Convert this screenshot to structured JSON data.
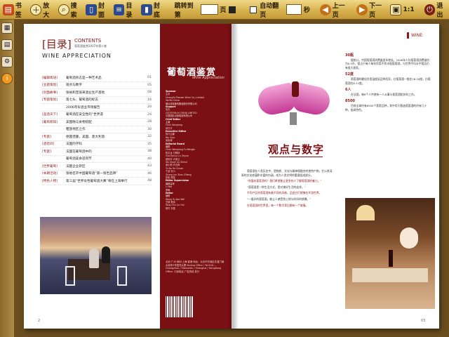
{
  "toolbar": {
    "bookmark": "书签",
    "zoom": "放大",
    "search": "搜索",
    "cover": "封面",
    "toc": "目录",
    "backcover": "封底",
    "jump_prefix": "跳转到第",
    "jump_suffix": "页",
    "autoflip": "自动翻页",
    "seconds": "秒",
    "prev": "上一页",
    "next": "下一页",
    "ratio": "1:1",
    "exit": "退出"
  },
  "contents": {
    "title": "[目录]",
    "en": "CONTENTS",
    "tiny": "葡萄酒鉴赏2007年第二卷",
    "wine_app": "WINE  APPRECIATION",
    "rows": [
      {
        "sec": "[编辑寄语]",
        "title": "葡萄酒杂志是一种艺术品",
        "pg": "01"
      },
      {
        "sec": "[主题策划]",
        "title": "观点与数字",
        "pg": "05"
      },
      {
        "sec": "[封面故事]",
        "title": "张裕和宝丽来酒业生产基地",
        "pg": "08"
      },
      {
        "sec": "[专题策划]",
        "title": "第七头、葡萄酒的标志",
        "pg": "16"
      },
      {
        "sec": "",
        "title": "2006年份酒业市场报告",
        "pg": "20"
      },
      {
        "sec": "[品酒天下]",
        "title": "葡萄酒在安全性的“世界遗",
        "pg": "24"
      },
      {
        "sec": "[葡萄新知]",
        "title": "美国晚与食物搭配",
        "pg": "28"
      },
      {
        "sec": "",
        "title": "粗放地区之作",
        "pg": "30"
      },
      {
        "sec": "[专题]",
        "title": "德国佳酿，美国、意大利酒",
        "pg": "32"
      },
      {
        "sec": "[酒窖间]",
        "title": "法国的学科",
        "pg": "35"
      },
      {
        "sec": "[专题]",
        "title": "法国在葡萄酒中的",
        "pg": "38"
      },
      {
        "sec": "",
        "title": "葡萄酒美食适风节",
        "pg": "40"
      },
      {
        "sec": "[世界葡萄]",
        "title": "法酿企业新区",
        "pg": "43"
      },
      {
        "sec": "[本期活动]",
        "title": "张裕召开中国葡萄酒“第一张世品牌”",
        "pg": "46"
      },
      {
        "sec": "[特色人物]",
        "title": "第三届“世界女性葡萄酒大赛”将在上海举行",
        "pg": "48"
      }
    ],
    "page_left": "2",
    "page_right": "01"
  },
  "masthead": {
    "title": "葡萄酒鉴赏",
    "sub": "Wine Appreciation",
    "lines": [
      {
        "t": "Sponsor",
        "h": true
      },
      {
        "t": "主办",
        "h": false
      },
      {
        "t": "ChangYu Pioneer Wine Co.,Limited",
        "h": false
      },
      {
        "t": "YanTai China",
        "h": false
      },
      {
        "t": "烟台张裕葡萄酿酒股份有限公司",
        "h": false
      },
      {
        "t": "Support",
        "h": true
      },
      {
        "t": "协办",
        "h": false
      },
      {
        "t": "CEDITION IN  CHINA  LIMITED",
        "h": false
      },
      {
        "t": "中国国际出版集团有限公司",
        "h": false
      },
      {
        "t": "Chief Editor",
        "h": true
      },
      {
        "t": "主编",
        "h": false
      },
      {
        "t": "Chen Kenglong",
        "h": false
      },
      {
        "t": "何汉平",
        "h": false
      },
      {
        "t": "Executive Editor",
        "h": true
      },
      {
        "t": "执行主编",
        "h": false
      },
      {
        "t": "Wu Suju",
        "h": false
      },
      {
        "t": "吴素菊",
        "h": false
      },
      {
        "t": "Editorial Board",
        "h": true
      },
      {
        "t": "编委",
        "h": false
      },
      {
        "t": "Chen Wenglong    Fu Minglin",
        "h": false
      },
      {
        "t": "陈文龙           付明林",
        "h": false
      },
      {
        "t": "Guo Jianyu       Lu Zeyun",
        "h": false
      },
      {
        "t": "郭剑宇           卢泽云",
        "h": false
      },
      {
        "t": "Wu Xiaoli        Xu Zhihui",
        "h": false
      },
      {
        "t": "吴小丽           许志辉",
        "h": false
      },
      {
        "t": "Yu Bo            He Chuan",
        "h": false
      },
      {
        "t": "于波             何川",
        "h": false
      },
      {
        "t": "Zhang Jun        Zhou Zheng",
        "h": false
      },
      {
        "t": "张军             周征",
        "h": false
      },
      {
        "t": "Editor Supervision",
        "h": true
      },
      {
        "t": "编辑监审",
        "h": false
      },
      {
        "t": "Li Mei",
        "h": false
      },
      {
        "t": "李梅",
        "h": false
      },
      {
        "t": "Editor",
        "h": true
      },
      {
        "t": "编辑",
        "h": false
      },
      {
        "t": "Wang Yu          Jiao Wei",
        "h": false
      },
      {
        "t": "王毓             焦伟",
        "h": false
      },
      {
        "t": "Yang Zhu         Liu Hui",
        "h": false
      },
      {
        "t": "杨竹             刘惠",
        "h": false
      }
    ],
    "addr": "北京·广州·深圳·上海·香港 地址：北京市东城区东直门南大街甲3号居然大厦 Beijing Office / Tel:010-... Guangzhou / Shenzhen / Shanghai / HongKong Office. 订阅电话 广告热线 发行"
  },
  "right": {
    "title": "观点与数字",
    "logo": "WINE",
    "paras": [
      "葡萄酒在人类历史中，是物质、文化与精神相融合的独特产物，它以其深厚的文化底蕴和丰富的内涵，成为人类文明的重要组成部分。",
      "“你喜欢葡萄酒吗？我们希望能让更多的人了解葡萄酒的魅力。”",
      "“葡萄酒是一种生活方式，是对美好生活的追求。”",
      "不同产区的葡萄酒有着不同的风格，品尝它们就像在环游世界。",
      "“一瓶好的葡萄酒，能让人感受到土地与时间的馈赠。”",
      "在葡萄酒的世界里，每一个数字背后都有一个故事。"
    ],
    "side": [
      {
        "h": "30瓶",
        "p": "据统计，中国葡萄酒消费量逐年增长，2006年人均葡萄酒消费量约为0.3升，相当于每人每年饮用不到半瓶葡萄酒，与世界平均水平相比仍有很大差距。"
      },
      {
        "h": "52度",
        "p": "葡萄酒的最佳饮用温度因品种而异，红葡萄酒一般在16-18度，白葡萄酒在8-12度。"
      },
      {
        "h": "6人",
        "p": "在法国，每6个人中就有一人从事与葡萄酒相关的工作。"
      },
      {
        "h": "8500",
        "p": "目前全球约有8500个葡萄品种，其中用于酿造葡萄酒的约有几十种，各具特色。"
      }
    ],
    "page_num": "03"
  }
}
